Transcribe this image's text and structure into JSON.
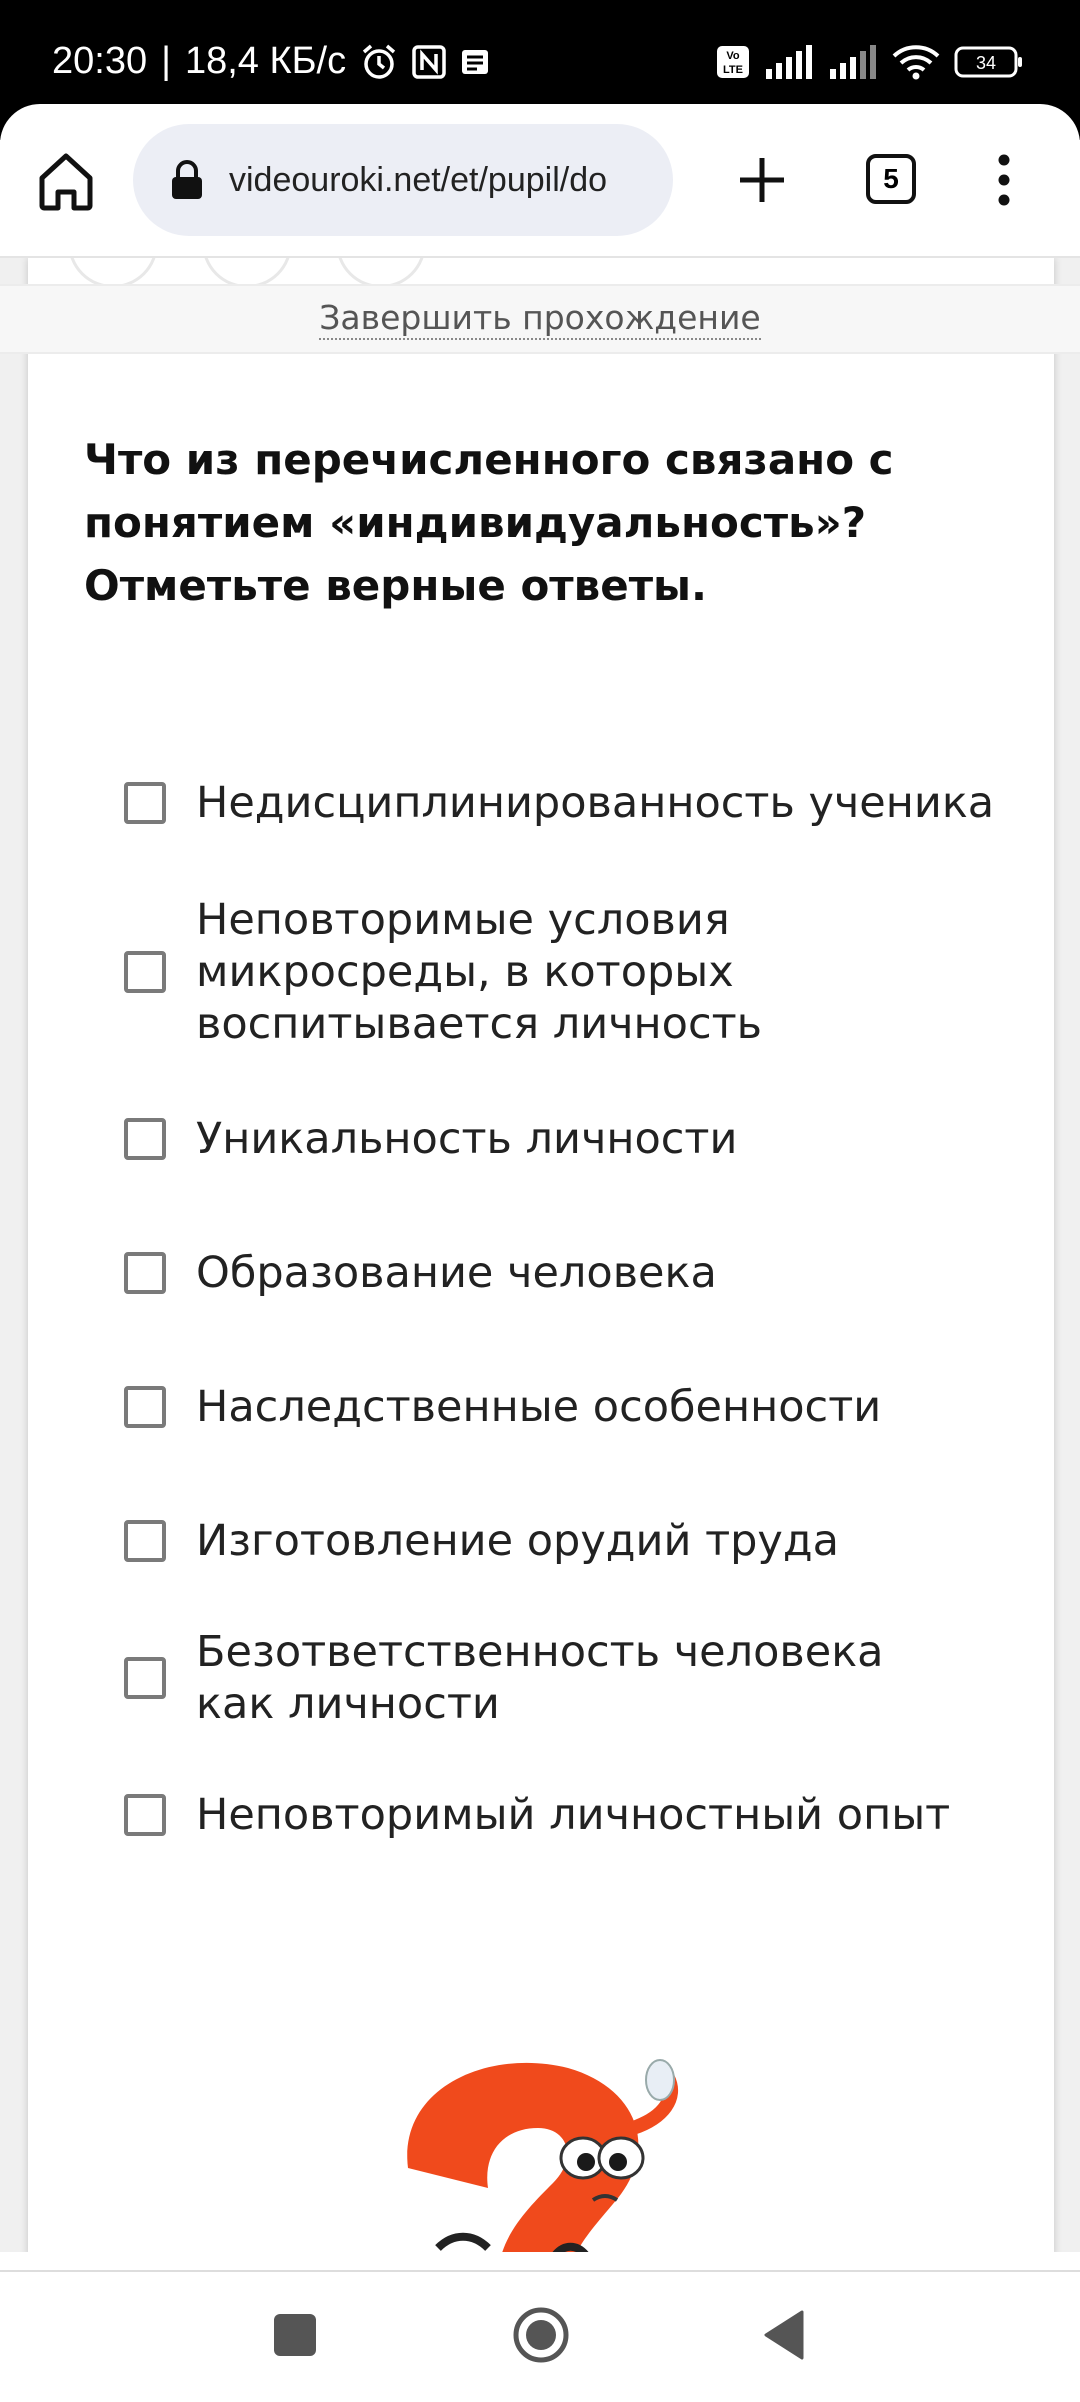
{
  "status_bar": {
    "time": "20:30",
    "separator": "|",
    "speed": "18,4 КБ/с",
    "lte_label": "Vo LTE",
    "battery": "34"
  },
  "browser": {
    "url": "videouroki.net/et/pupil/do",
    "tab_count": "5"
  },
  "test": {
    "finish_link": "Завершить прохождение",
    "question": "Что из перечисленного связано с понятием «индивидуальность»? Отметьте верные ответы.",
    "options": [
      {
        "label": "Недисциплинированность ученика"
      },
      {
        "label": "Неповторимые условия микросреды, в которых воспитывается личность"
      },
      {
        "label": "Уникальность личности"
      },
      {
        "label": "Образование человека"
      },
      {
        "label": "Наследственные особенности"
      },
      {
        "label": "Изготовление орудий труда"
      },
      {
        "label": "Безответственность человека как личности"
      },
      {
        "label": "Неповторимый личностный опыт"
      }
    ]
  },
  "colors": {
    "mascot": "#f04a1c",
    "checkbox_border": "#7a7a7a"
  },
  "icons": {
    "status": [
      "alarm-icon",
      "nfc-icon",
      "message-icon",
      "signal-icon",
      "wifi-icon",
      "battery-icon"
    ],
    "toolbar": [
      "home-icon",
      "lock-icon",
      "plus-icon",
      "tabs-icon",
      "more-vert-icon"
    ],
    "nav": [
      "recents-icon",
      "home-circle-icon",
      "back-icon"
    ]
  }
}
